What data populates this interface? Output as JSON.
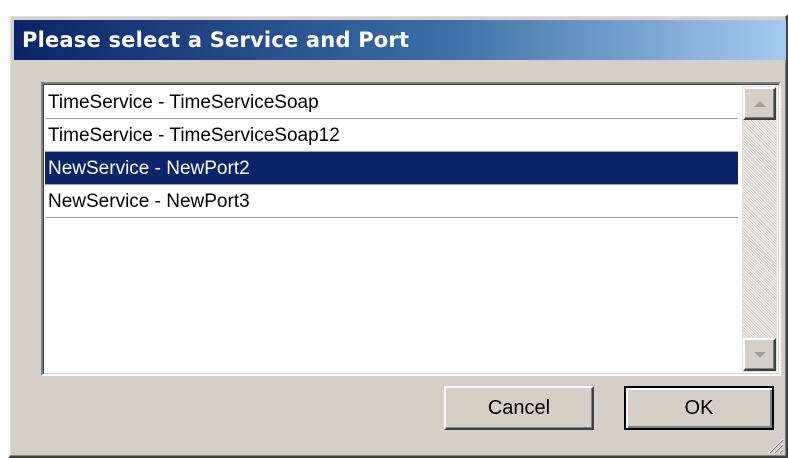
{
  "dialog": {
    "title": "Please select a Service and Port"
  },
  "list": {
    "items": [
      {
        "label": "TimeService - TimeServiceSoap",
        "selected": false
      },
      {
        "label": "TimeService - TimeServiceSoap12",
        "selected": false
      },
      {
        "label": "NewService - NewPort2",
        "selected": true
      },
      {
        "label": "NewService - NewPort3",
        "selected": false
      }
    ],
    "selected_index": 2
  },
  "scrollbar": {
    "up_icon": "scroll-up-arrow",
    "down_icon": "scroll-down-arrow"
  },
  "buttons": {
    "cancel_label": "Cancel",
    "ok_label": "OK"
  },
  "colors": {
    "title_start": "#0a246a",
    "title_end": "#a6caf0",
    "selection": "#0a246a",
    "face": "#d4d0c8"
  }
}
